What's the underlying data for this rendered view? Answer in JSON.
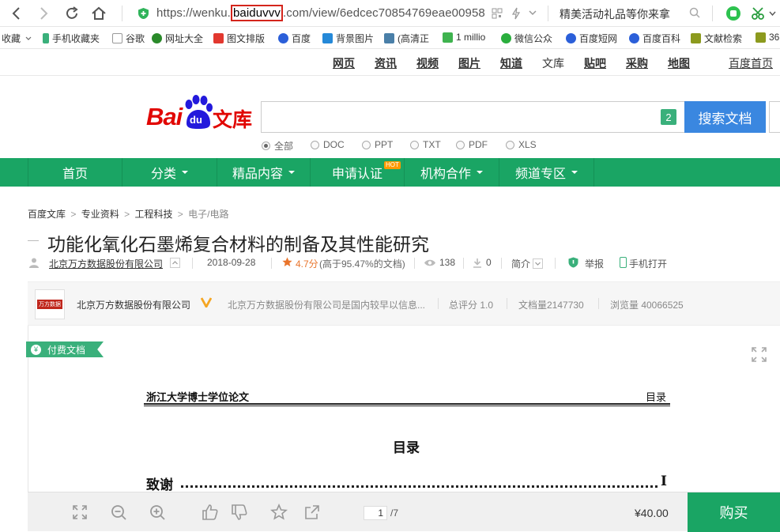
{
  "browser": {
    "url_prefix": "https://wenku.",
    "url_highlight": "baiduvvv",
    "url_suffix": ".com/view/6edcec70854769eae00958",
    "ad_text": "精美活动礼品等你来拿"
  },
  "bookmarks": [
    {
      "label": "收藏",
      "color": "#f5a623"
    },
    {
      "label": "手机收藏夹",
      "color": "#3ab07b"
    },
    {
      "label": "谷歌",
      "color": "#999999"
    },
    {
      "label": "网址大全",
      "color": "#2a8a2a"
    },
    {
      "label": "图文排版",
      "color": "#e2382f"
    },
    {
      "label": "百度",
      "color": "#2b5fd9"
    },
    {
      "label": "背景图片",
      "color": "#2589d8"
    },
    {
      "label": "(高清正",
      "color": "#4a7fa8"
    },
    {
      "label": "1 millio",
      "color": "#3fb34f"
    },
    {
      "label": "微信公众",
      "color": "#2aae3d"
    },
    {
      "label": "百度短网",
      "color": "#2b5fd9"
    },
    {
      "label": "百度百科",
      "color": "#2b5fd9"
    },
    {
      "label": "文献检索",
      "color": "#8c9a1e"
    },
    {
      "label": "36",
      "color": "#8c9a1e"
    }
  ],
  "topnav": [
    "网页",
    "资讯",
    "视频",
    "图片",
    "知道",
    "文库",
    "贴吧",
    "采购",
    "地图"
  ],
  "topnav_home": "百度首页",
  "logo": {
    "bai": "Bai",
    "du": "du",
    "wenku": "文库"
  },
  "search": {
    "badge": "2",
    "button": "搜索文档"
  },
  "filters": {
    "options": [
      "全部",
      "DOC",
      "PPT",
      "TXT",
      "PDF",
      "XLS"
    ],
    "selected": "全部"
  },
  "greennav": [
    {
      "label": "首页",
      "dropdown": false
    },
    {
      "label": "分类",
      "dropdown": true
    },
    {
      "label": "精品内容",
      "dropdown": true
    },
    {
      "label": "申请认证",
      "dropdown": false,
      "badge": "HOT"
    },
    {
      "label": "机构合作",
      "dropdown": true
    },
    {
      "label": "频道专区",
      "dropdown": true
    }
  ],
  "breadcrumb": [
    "百度文库",
    "专业资料",
    "工程科技",
    "电子/电路"
  ],
  "doc": {
    "title": "功能化氧化石墨烯复合材料的制备及其性能研究",
    "author": "北京万方数据股份有限公司",
    "date": "2018-09-28",
    "rating": "4.7分",
    "rating_note": "(高于95.47%的文档)",
    "views": "138",
    "downloads": "0",
    "summary_label": "简介",
    "report_label": "举报",
    "mobile_label": "手机打开"
  },
  "org": {
    "logo_text": "万方数据",
    "name": "北京万方数据股份有限公司",
    "desc": "北京万方数据股份有限公司是国内较早以信息...",
    "score": "总评分 1.0",
    "doc_count": "文档量2147730",
    "view_count": "浏览量 40066525"
  },
  "paid_label": "付费文档",
  "thesis": {
    "header_left": "浙江大学博士学位论文",
    "header_right": "目录",
    "heading": "目录",
    "toc_label": "致谢",
    "toc_page": "I"
  },
  "toolbar": {
    "page_current": "1",
    "page_total": "/7",
    "price": "¥40.00",
    "buy_label": "购买"
  }
}
